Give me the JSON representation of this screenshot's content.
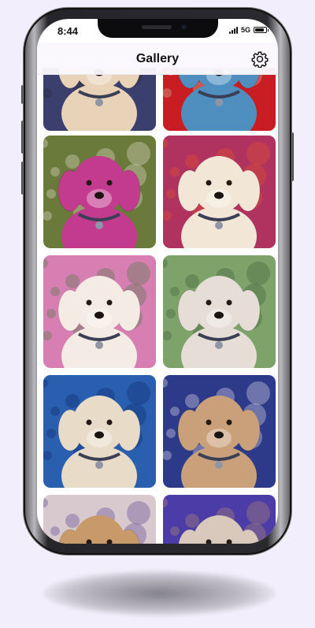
{
  "status_bar": {
    "time": "8:44",
    "network": "5G",
    "signal_bars_filled": 4,
    "battery_level": 0.85
  },
  "nav": {
    "title": "Gallery",
    "settings_icon": "gear-icon"
  },
  "gallery": {
    "items": [
      {
        "subject": "dog-portrait",
        "palette": [
          "#3b3f6e",
          "#e8d2b8",
          "#2a2a2a"
        ]
      },
      {
        "subject": "dog-portrait",
        "palette": [
          "#c81d22",
          "#4f8fbf",
          "#d6c0a4"
        ]
      },
      {
        "subject": "dog-portrait",
        "palette": [
          "#6a7a3a",
          "#c23b8f",
          "#e9e2d8"
        ]
      },
      {
        "subject": "dog-portrait",
        "palette": [
          "#b0325e",
          "#f2e6d6",
          "#e8572a"
        ]
      },
      {
        "subject": "dog-portrait",
        "palette": [
          "#d77fb2",
          "#f4ece4",
          "#4a7a40"
        ]
      },
      {
        "subject": "dog-portrait",
        "palette": [
          "#7da36a",
          "#e5ddd6",
          "#3e5c3a"
        ]
      },
      {
        "subject": "dog-portrait",
        "palette": [
          "#2a5fb0",
          "#e8dcc8",
          "#0f2c6a"
        ]
      },
      {
        "subject": "dog-portrait",
        "palette": [
          "#2d3a8a",
          "#c9a07a",
          "#e8e2ea"
        ]
      },
      {
        "subject": "dog-portrait",
        "palette": [
          "#d8c9cf",
          "#c89a6a",
          "#5b3c8a"
        ]
      },
      {
        "subject": "dog-portrait",
        "palette": [
          "#4b3ca8",
          "#d9c8bc",
          "#b78b6a"
        ]
      }
    ]
  }
}
